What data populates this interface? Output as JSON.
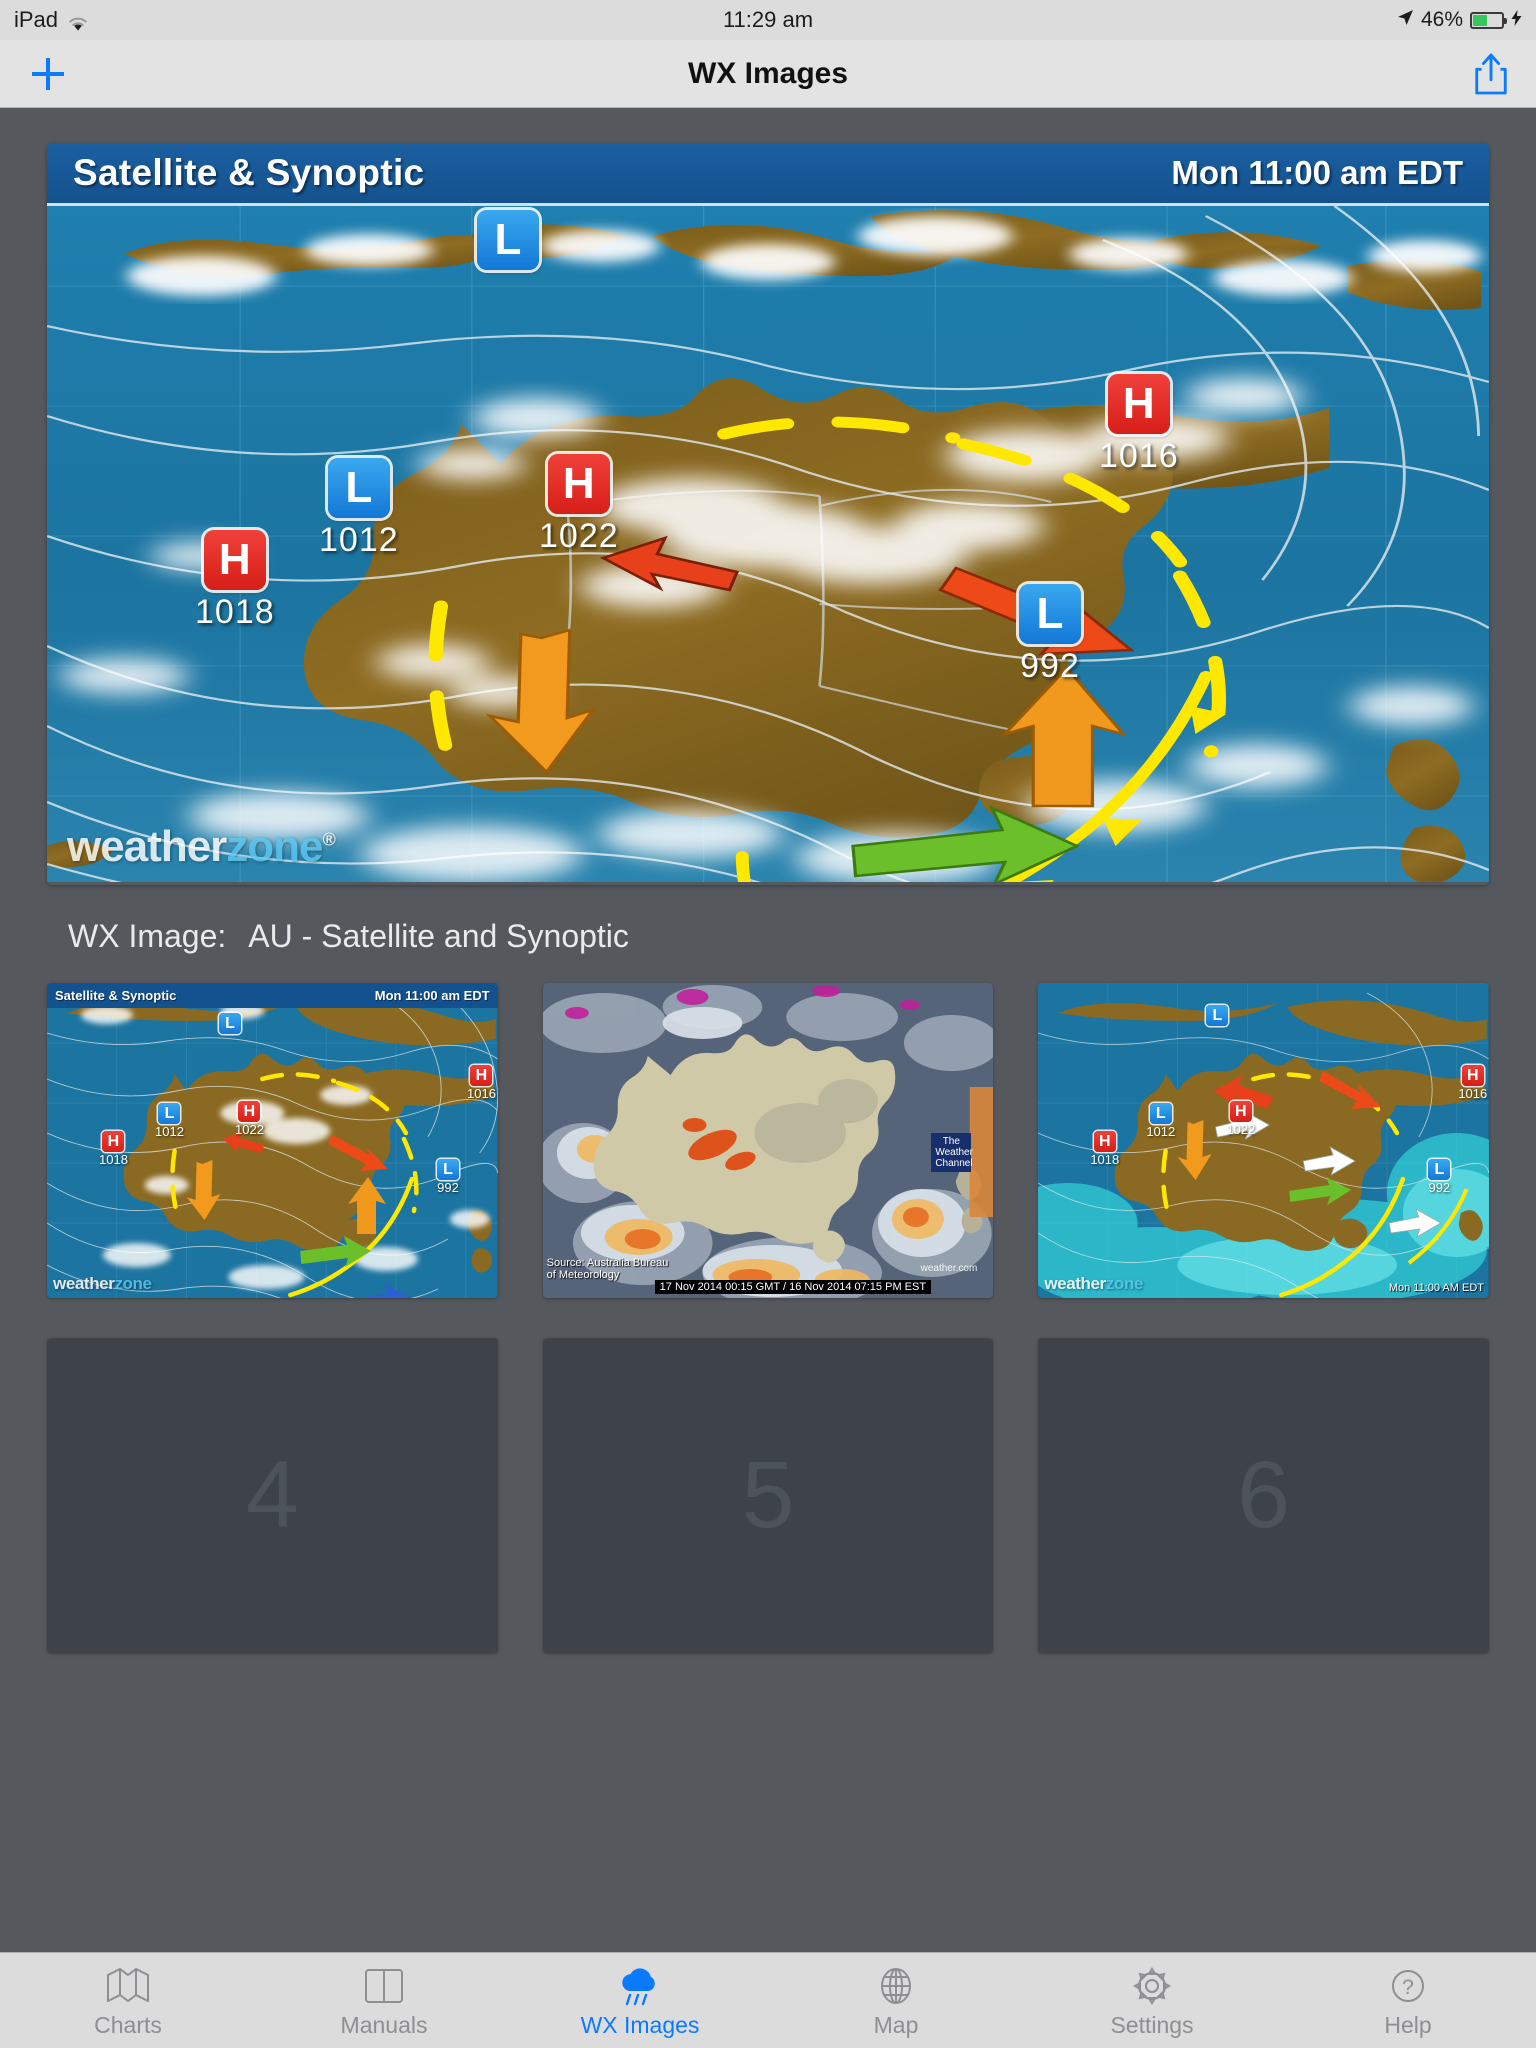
{
  "status_bar": {
    "device": "iPad",
    "wifi_icon": "wifi-icon",
    "time": "11:29 am",
    "location_icon": "location-arrow-icon",
    "battery_percent": "46%",
    "battery_level": 46,
    "charging": true
  },
  "nav_bar": {
    "add_icon": "plus-icon",
    "title": "WX Images",
    "share_icon": "share-icon"
  },
  "hero": {
    "header_title": "Satellite & Synoptic",
    "header_time": "Mon 11:00 am EDT",
    "watermark": "weather",
    "watermark_accent": "zone",
    "watermark_reg": "®",
    "pressure_systems": [
      {
        "type": "L",
        "value": "",
        "label": "low-darwin"
      },
      {
        "type": "L",
        "value": "1012",
        "label": "low-perth-south"
      },
      {
        "type": "H",
        "value": "1018",
        "label": "high-southwest-ocean"
      },
      {
        "type": "H",
        "value": "1022",
        "label": "high-great-australian-bight"
      },
      {
        "type": "H",
        "value": "1016",
        "label": "high-east-pacific"
      },
      {
        "type": "L",
        "value": "992",
        "label": "low-tasman-sea"
      }
    ]
  },
  "caption": {
    "label": "WX Image:",
    "value": "AU - Satellite and Synoptic"
  },
  "thumbnails": [
    {
      "id": "thumb-1",
      "kind": "satellite-synoptic",
      "header_title": "Satellite & Synoptic",
      "header_time": "Mon 11:00 am EDT",
      "watermark": "weather",
      "watermark_accent": "zone",
      "pressure_systems": [
        {
          "type": "L",
          "value": ""
        },
        {
          "type": "H",
          "value": "1018"
        },
        {
          "type": "L",
          "value": "1012"
        },
        {
          "type": "H",
          "value": "1022"
        },
        {
          "type": "H",
          "value": "1016"
        },
        {
          "type": "L",
          "value": "992"
        }
      ]
    },
    {
      "id": "thumb-2",
      "kind": "infrared-satellite",
      "source_line1": "Source: Australia Bureau",
      "source_line2": "of Meteorology",
      "timestamp_ribbon": "17 Nov 2014 00:15 GMT / 16 Nov 2014 07:15 PM EST",
      "channel_badge": "The Weather Channel",
      "channel_url": "weather.com"
    },
    {
      "id": "thumb-3",
      "kind": "satellite-synoptic-rain",
      "watermark": "weather",
      "watermark_accent": "zone",
      "timestamp": "Mon 11:00 AM EDT",
      "pressure_systems": [
        {
          "type": "L",
          "value": ""
        },
        {
          "type": "H",
          "value": "1018"
        },
        {
          "type": "L",
          "value": "1012"
        },
        {
          "type": "H",
          "value": "1022"
        },
        {
          "type": "H",
          "value": "1016"
        },
        {
          "type": "L",
          "value": "992"
        }
      ]
    },
    {
      "id": "thumb-4",
      "kind": "empty",
      "placeholder": "4"
    },
    {
      "id": "thumb-5",
      "kind": "empty",
      "placeholder": "5"
    },
    {
      "id": "thumb-6",
      "kind": "empty",
      "placeholder": "6"
    }
  ],
  "tab_bar": {
    "active": "WX Images",
    "accent_color": "#0a7bff",
    "inactive_color": "#8e8e93",
    "items": [
      {
        "label": "Charts",
        "icon": "map-fold-icon",
        "active": false
      },
      {
        "label": "Manuals",
        "icon": "book-icon",
        "active": false
      },
      {
        "label": "WX Images",
        "icon": "rain-cloud-icon",
        "active": true
      },
      {
        "label": "Map",
        "icon": "globe-icon",
        "active": false
      },
      {
        "label": "Settings",
        "icon": "gear-icon",
        "active": false
      },
      {
        "label": "Help",
        "icon": "question-circle-icon",
        "active": false
      }
    ]
  },
  "colors": {
    "background": "#55595e",
    "chrome": "#dcdcdc",
    "hero_header_blue": "#14528f",
    "ocean": "#1c74a0",
    "land": "#8a6a22",
    "accent": "#0a7bff"
  }
}
